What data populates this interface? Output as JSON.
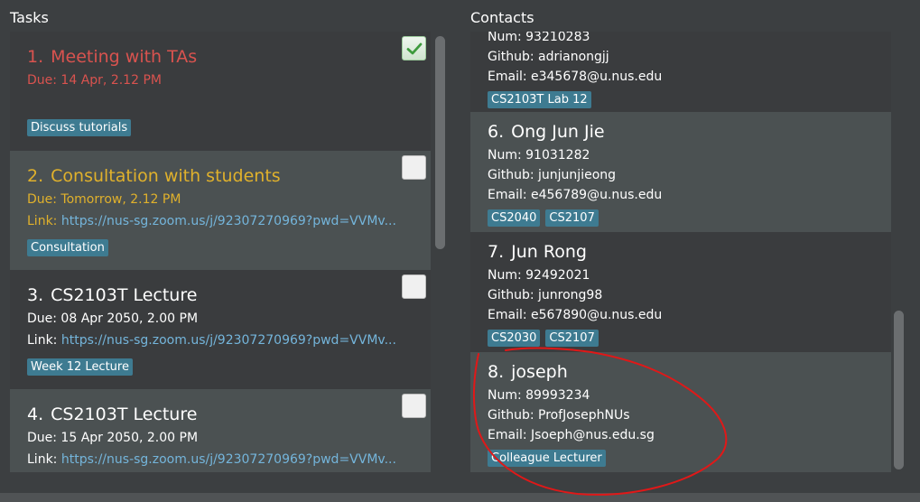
{
  "tasks_panel": {
    "title": "Tasks",
    "tasks": [
      {
        "number": "1.",
        "title": "Meeting with TAs",
        "due": "Due: 14 Apr, 2.12 PM",
        "tag": "Discuss tutorials",
        "checked": true,
        "status_color": "#d9534f"
      },
      {
        "number": "2.",
        "title": "Consultation with students",
        "due": "Due: Tomorrow, 2.12 PM",
        "link_label": "Link:",
        "link_url": "https://nus-sg.zoom.us/j/92307270969?pwd=VVMv...",
        "tag": "Consultation",
        "checked": false,
        "status_color": "#e0b12c"
      },
      {
        "number": "3.",
        "title": "CS2103T Lecture",
        "due": "Due: 08 Apr 2050, 2.00 PM",
        "link_label": "Link:",
        "link_url": "https://nus-sg.zoom.us/j/92307270969?pwd=VVMv...",
        "tag": "Week 12 Lecture",
        "checked": false
      },
      {
        "number": "4.",
        "title": "CS2103T Lecture",
        "due": "Due: 15 Apr 2050, 2.00 PM",
        "link_label": "Link:",
        "link_url": "https://nus-sg.zoom.us/j/92307270969?pwd=VVMv...",
        "checked": false
      }
    ]
  },
  "contacts_panel": {
    "title": "Contacts",
    "contacts": [
      {
        "num": "Num: 93210283",
        "github": "Github: adrianongjj",
        "email": "Email: e345678@u.nus.edu",
        "tags": [
          "CS2103T Lab 12"
        ]
      },
      {
        "number": "6.",
        "name": "Ong Jun Jie",
        "num": "Num: 91031282",
        "github": "Github: junjunjieong",
        "email": "Email: e456789@u.nus.edu",
        "tags": [
          "CS2040",
          "CS2107"
        ]
      },
      {
        "number": "7.",
        "name": "Jun Rong",
        "num": "Num: 92492021",
        "github": "Github: junrong98",
        "email": "Email: e567890@u.nus.edu",
        "tags": [
          "CS2030",
          "CS2107"
        ]
      },
      {
        "number": "8.",
        "name": "joseph",
        "num": "Num: 89993234",
        "github": "Github: ProfJosephNUs",
        "email": "Email: Jsoeph@nus.edu.sg",
        "tags": [
          "Colleague Lecturer"
        ]
      }
    ]
  },
  "colors": {
    "background": "#3c3f41",
    "card_dark": "#3a3c3e",
    "card_light": "#4b5152",
    "tag": "#3e7b91",
    "link": "#74b5db",
    "overdue": "#d9534f",
    "due_soon": "#e0b12c",
    "annotation": "#e01818"
  },
  "icons": {
    "checked": "checkmark-icon"
  }
}
